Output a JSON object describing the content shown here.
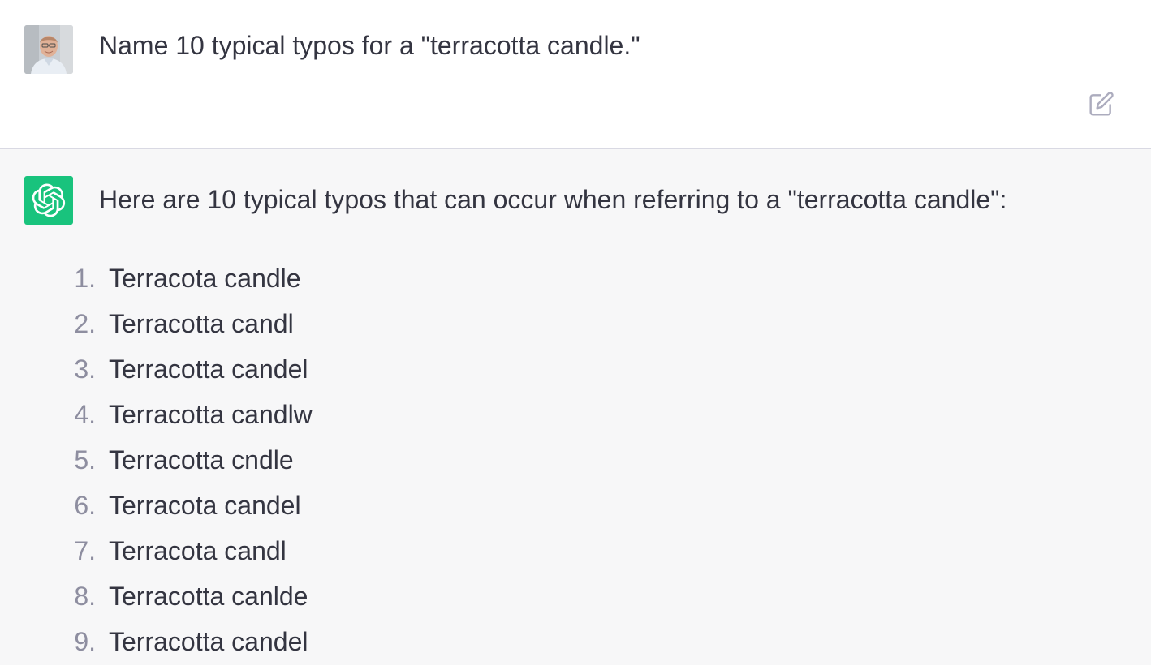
{
  "user_message": {
    "text": "Name 10 typical typos for a \"terracotta candle.\"",
    "avatar_icon": "user-avatar-photo",
    "edit_icon": "edit-pencil-icon"
  },
  "assistant_message": {
    "avatar_icon": "openai-logo-icon",
    "avatar_color": "#19c37d",
    "intro": "Here are 10 typical typos that can occur when referring to a \"terracotta candle\":",
    "items": [
      {
        "num": "1.",
        "text": "Terracota candle"
      },
      {
        "num": "2.",
        "text": "Terracotta candl"
      },
      {
        "num": "3.",
        "text": "Terracotta candel"
      },
      {
        "num": "4.",
        "text": "Terracotta candlw"
      },
      {
        "num": "5.",
        "text": "Terracotta cndle"
      },
      {
        "num": "6.",
        "text": "Terracota candel"
      },
      {
        "num": "7.",
        "text": "Terracota candl"
      },
      {
        "num": "8.",
        "text": "Terracotta canlde"
      },
      {
        "num": "9.",
        "text": "Terracotta candel"
      }
    ]
  },
  "colors": {
    "assistant_bg": "#f7f7f8",
    "text": "#343541",
    "list_number": "#8e8ea0"
  }
}
